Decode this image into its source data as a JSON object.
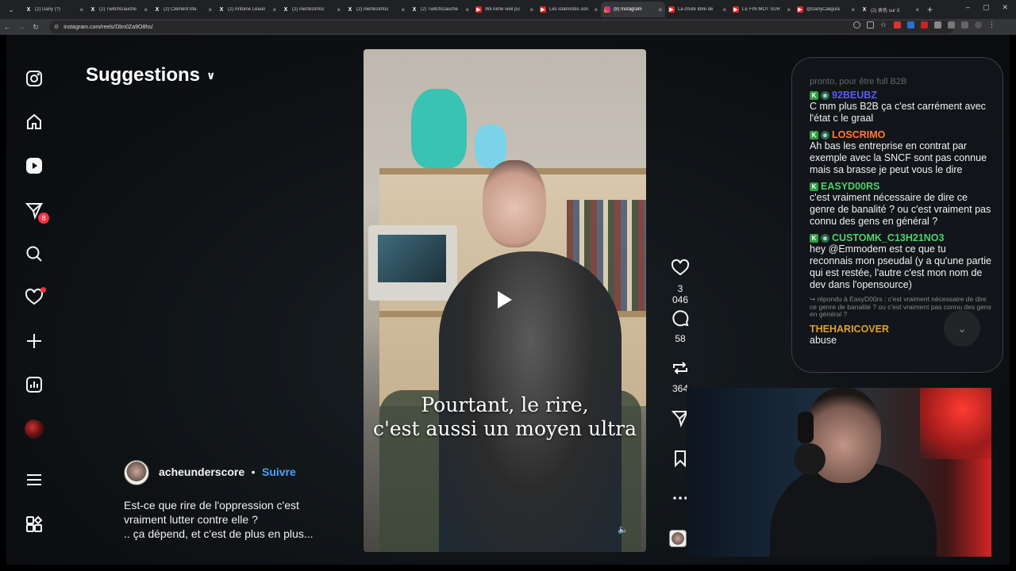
{
  "browser": {
    "tab_menu_icon": "chevron-down",
    "tabs": [
      {
        "label": "(2) Dany (?)",
        "icon": "x"
      },
      {
        "label": "(2) TwitchGauche",
        "icon": "x"
      },
      {
        "label": "(2) Clément Ma",
        "icon": "x"
      },
      {
        "label": "(2) Antoine Léaun",
        "icon": "x"
      },
      {
        "label": "(2) AlertesInfos",
        "icon": "x"
      },
      {
        "label": "(2) AlertesInfos",
        "icon": "x"
      },
      {
        "label": "(2) TwitchGauche",
        "icon": "x"
      },
      {
        "label": "Wil Aime vieil pu",
        "icon": "yt"
      },
      {
        "label": "Les islamistes son",
        "icon": "yt"
      },
      {
        "label": "(8) Instagram",
        "icon": "ig",
        "active": true
      },
      {
        "label": "La chute libre de",
        "icon": "yt"
      },
      {
        "label": "LE FIN MOT SUR",
        "icon": "yt"
      },
      {
        "label": "@DanyCaligula",
        "icon": "yt"
      },
      {
        "label": "(2) 表色 sur X",
        "icon": "x"
      }
    ],
    "new_tab": "+",
    "window_controls": [
      "–",
      "▢",
      "✕"
    ],
    "url": "instagram.com/reels/Dbn0Za9O8hs/"
  },
  "sidebar": {
    "items": [
      {
        "name": "instagram-logo-icon"
      },
      {
        "name": "home-icon"
      },
      {
        "name": "reels-icon"
      },
      {
        "name": "messages-icon",
        "badge": "8"
      },
      {
        "name": "search-icon"
      },
      {
        "name": "notifications-icon",
        "dot": true
      },
      {
        "name": "create-icon"
      },
      {
        "name": "dashboard-icon"
      },
      {
        "name": "profile-avatar"
      },
      {
        "name": "menu-icon"
      },
      {
        "name": "more-apps-icon"
      }
    ]
  },
  "header": {
    "title": "Suggestions"
  },
  "reel": {
    "caption_line1": "Pourtant, le rire,",
    "caption_line2": "c'est aussi un moyen ultra",
    "author": "acheunderscore",
    "separator": "•",
    "follow": "Suivre",
    "description_1": "Est-ce que rire de l'oppression c'est",
    "description_2": "vraiment lutter contre elle ?",
    "description_3": ".. ça dépend, et c'est de plus en plus..."
  },
  "actions": {
    "likes": "3 046",
    "comments": "58",
    "reposts": "364"
  },
  "chat": {
    "faded_top": "pronto, pour être full B2B",
    "messages": [
      {
        "user": "92BEUBZ",
        "color": "#5c5cf0",
        "badges": [
          "K",
          "S"
        ],
        "text": "C mm plus B2B ça c'est carrément avec l'état c le graal"
      },
      {
        "user": "LOSCRIMO",
        "color": "#ff7a3c",
        "badges": [
          "K",
          "S"
        ],
        "text": "Ah bas les entreprise en contrat par exemple avec la SNCF sont pas connue mais sa brasse je peut vous le dire"
      },
      {
        "user": "EASYD00RS",
        "color": "#4bd36b",
        "badges": [
          "K"
        ],
        "text": "c'est vraiment nécessaire de dire ce genre de banalité ? ou c'est vraiment pas connu des gens en général ?"
      },
      {
        "user": "CUSTOMK_C13H21NO3",
        "color": "#4bd36b",
        "badges": [
          "K",
          "S"
        ],
        "text": "hey @Emmodem est ce que tu reconnais mon pseudal (y a qu'une partie qui est restée, l'autre c'est mon nom de dev dans l'opensource)"
      }
    ],
    "reply_note": "↪ répondu à EasyD00rs : c'est vraiment nécessaire de dire ce genre de banalité ? ou c'est vraiment pas connu des gens en général ?",
    "last_user": "THEHARICOVER",
    "last_user_color": "#e0a030",
    "last_text": "abuse"
  }
}
